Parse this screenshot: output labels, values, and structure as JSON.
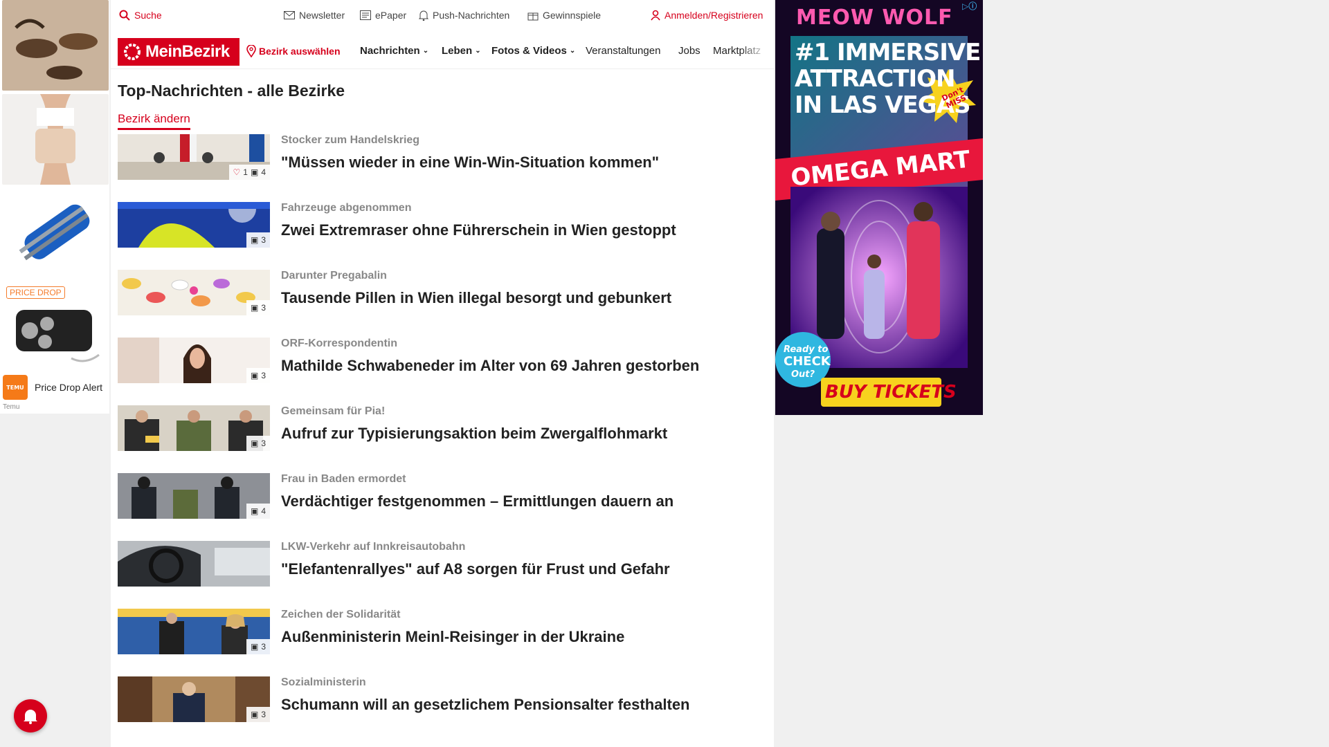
{
  "left_ad": {
    "badge": "PRICE DROP",
    "brand_logo_text": "TEMU",
    "title": "Price Drop Alert",
    "sponsor": "Temu"
  },
  "topbar": {
    "search": "Suche",
    "newsletter": "Newsletter",
    "epaper": "ePaper",
    "push": "Push-Nachrichten",
    "gewinnspiele": "Gewinnspiele",
    "login": "Anmelden/Registrieren"
  },
  "nav": {
    "logo": "MeinBezirk",
    "bezirk": "Bezirk auswählen",
    "items": [
      "Nachrichten",
      "Leben",
      "Fotos & Videos",
      "Veranstaltungen",
      "Jobs",
      "Marktplatz"
    ]
  },
  "page": {
    "title": "Top-Nachrichten - alle Bezirke",
    "change_district": "Bezirk ändern"
  },
  "articles": [
    {
      "kicker": "Stocker zum Handelskrieg",
      "headline": "\"Müssen wieder in eine Win-Win-Situation kommen\"",
      "likes": "1",
      "photos": "4"
    },
    {
      "kicker": "Fahrzeuge abgenommen",
      "headline": "Zwei Extremraser ohne Führerschein in Wien gestoppt",
      "photos": "3"
    },
    {
      "kicker": "Darunter Pregabalin",
      "headline": "Tausende Pillen in Wien illegal besorgt und gebunkert",
      "photos": "3"
    },
    {
      "kicker": "ORF-Korrespondentin",
      "headline": "Mathilde Schwabeneder im Alter von 69 Jahren gestorben",
      "photos": "3"
    },
    {
      "kicker": "Gemeinsam für Pia!",
      "headline": "Aufruf zur Typisierungsaktion beim Zwergalflohmarkt",
      "photos": "3"
    },
    {
      "kicker": "Frau in Baden ermordet",
      "headline": "Verdächtiger festgenommen – Ermittlungen dauern an",
      "photos": "4"
    },
    {
      "kicker": "LKW-Verkehr auf Innkreisautobahn",
      "headline": "\"Elefantenrallyes\" auf A8 sorgen für Frust und Gefahr",
      "photos": ""
    },
    {
      "kicker": "Zeichen der Solidarität",
      "headline": "Außenministerin Meinl-Reisinger in der Ukraine",
      "photos": "3"
    },
    {
      "kicker": "Sozialministerin",
      "headline": "Schumann will an gesetzlichem Pensionsalter festhalten",
      "photos": "3"
    }
  ],
  "right_ad": {
    "brand": "MEOW WOLF",
    "headline_1": "#1 IMMERSIVE",
    "headline_2": "ATTRACTION",
    "headline_3": "IN LAS VEGAS",
    "burst": "Don't MISS",
    "venue": "OMEGA MART",
    "badge_1": "Ready to",
    "badge_2": "CHECK",
    "badge_3": "Out?",
    "cta": "BUY TICKETS"
  },
  "colors": {
    "brand_red": "#d6001c",
    "kicker_gray": "#888888",
    "ad_cta_yellow": "#f7d21e"
  }
}
